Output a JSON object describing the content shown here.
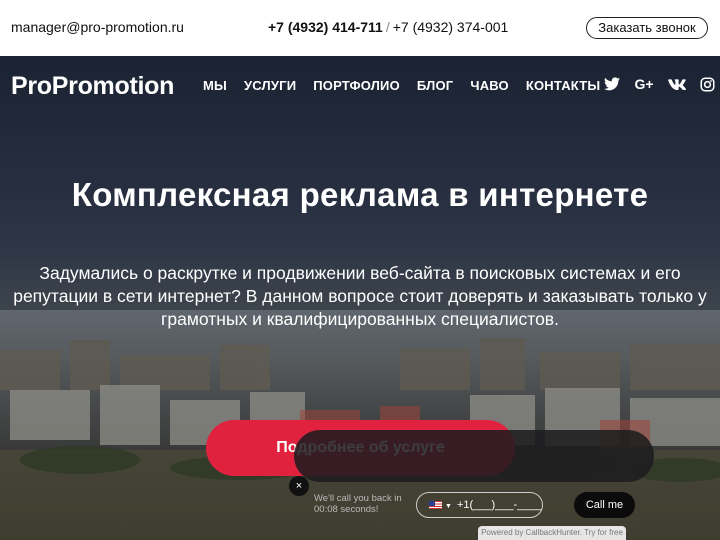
{
  "topbar": {
    "email": "manager@pro-promotion.ru",
    "phone_primary": "+7 (4932) 414-711",
    "phone_separator": "/",
    "phone_secondary": "+7 (4932) 374-001",
    "callback_button": "Заказать звонок"
  },
  "header": {
    "logo": "ProPromotion",
    "nav": [
      "МЫ",
      "УСЛУГИ",
      "ПОРТФОЛИО",
      "БЛОГ",
      "ЧАВО",
      "КОНТАКТЫ"
    ],
    "social_icons": [
      "twitter-icon",
      "google-plus-icon",
      "vk-icon",
      "instagram-icon"
    ],
    "google_plus_glyph": "G+"
  },
  "hero": {
    "title": "Комплексная реклама в интернете",
    "lead": "Задумались о раскрутке и продвижении веб-сайта в поисковых системах и его репутации в сети интернет? В данном вопросе стоит доверять и заказывать только у грамотных и квалифицированных специалистов.",
    "cta": "Подробнее об услуге"
  },
  "callback_widget": {
    "close": "×",
    "message": "We'll call you back in 00:08 seconds!",
    "phone_placeholder": "+1(___)___-____",
    "call_button": "Call me",
    "powered_by": "Powered by CallbackHunter. Try for free"
  },
  "colors": {
    "accent": "#e0223f",
    "header_text": "#ffffff",
    "hero_overlay": "#1e2638"
  }
}
